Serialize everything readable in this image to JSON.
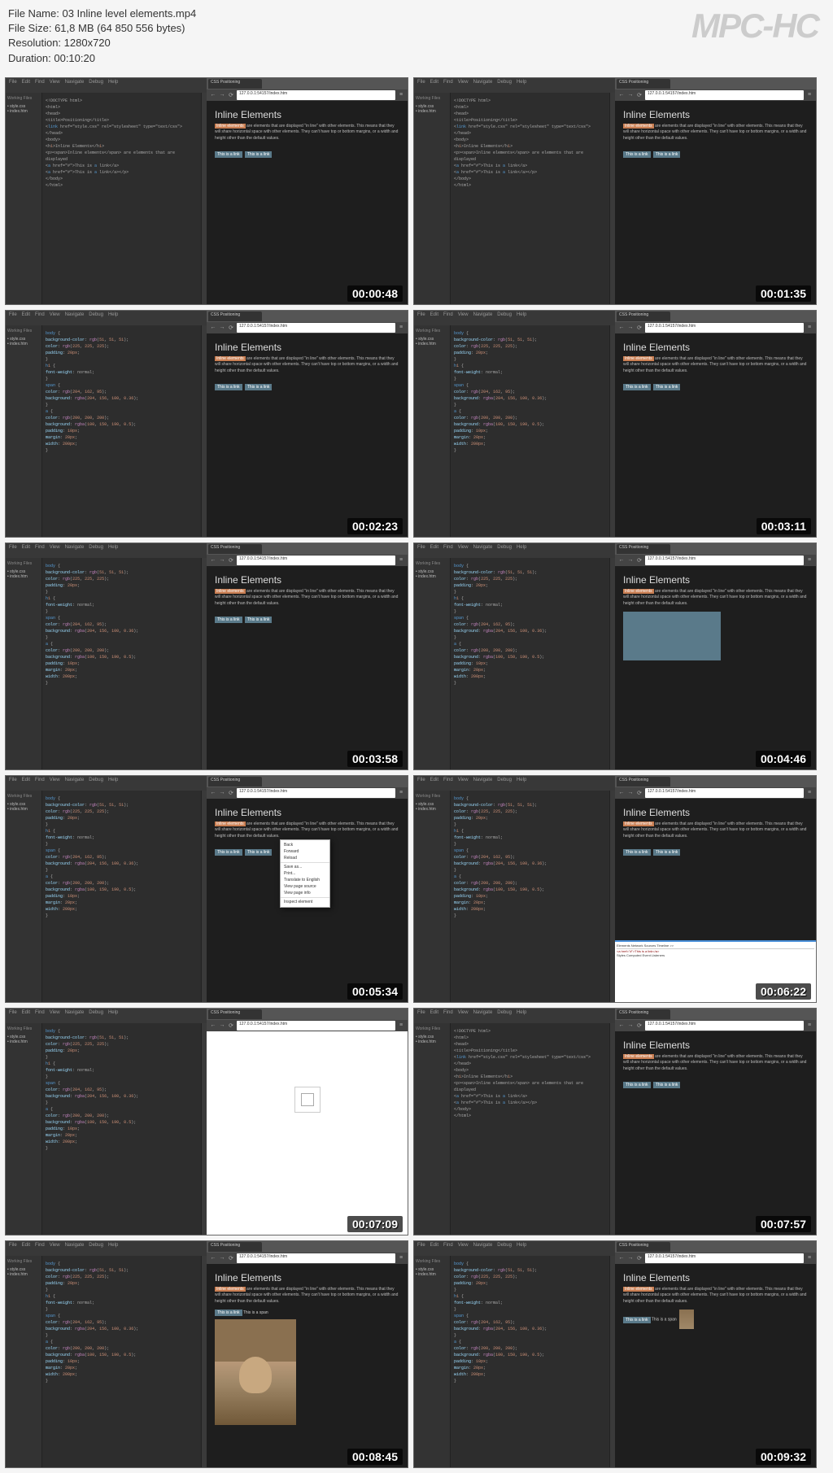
{
  "meta": {
    "filename_label": "File Name: 03 Inline level elements.mp4",
    "filesize_label": "File Size: 61,8 MB (64 850 556 bytes)",
    "resolution_label": "Resolution: 1280x720",
    "duration_label": "Duration: 00:10:20",
    "logo": "MPC-HC"
  },
  "common": {
    "menus": [
      "File",
      "Edit",
      "Find",
      "View",
      "Navigate",
      "Debug",
      "Help"
    ],
    "sidebar_label": "Working Files",
    "url": "127.0.0.1:54157/index.htm",
    "tab_title": "CSS Positioning",
    "heading": "Inline Elements",
    "para_prefix": "Inline elements",
    "para1": "are elements that are displayed \"in line\" with other elements. This means that they will share horizontal space with other elements. They can't have top or bottom margins, or a width and height other than the default values.",
    "para2": "are elements that are displayed \"in line\" with other elements. This means that they will share horizontal space with other elements. They can't have top or bottom margins, or a width and height other than the default values.",
    "link_text": "This is a link",
    "span_text": "This is a span"
  },
  "thumbs": [
    {
      "ts": "00:00:48",
      "kind": "html"
    },
    {
      "ts": "00:01:35",
      "kind": "html"
    },
    {
      "ts": "00:02:23",
      "kind": "css"
    },
    {
      "ts": "00:03:11",
      "kind": "css"
    },
    {
      "ts": "00:03:58",
      "kind": "css"
    },
    {
      "ts": "00:04:46",
      "kind": "css",
      "bigbox": true
    },
    {
      "ts": "00:05:34",
      "kind": "css",
      "ctx": true
    },
    {
      "ts": "00:06:22",
      "kind": "css",
      "devtools": true
    },
    {
      "ts": "00:07:09",
      "kind": "css",
      "light": true
    },
    {
      "ts": "00:07:57",
      "kind": "html"
    },
    {
      "ts": "00:08:45",
      "kind": "css",
      "img": true
    },
    {
      "ts": "00:09:32",
      "kind": "css",
      "imgsm": true
    }
  ],
  "ctx_items": [
    "Back",
    "Forward",
    "Reload",
    "",
    "Save as...",
    "Print...",
    "Translate to English",
    "View page source",
    "View page info",
    "",
    "Inspect element"
  ],
  "code_html": "<!DOCTYPE html>\n<html>\n <head>\n  <title>Positioning</title>\n  <link href=\"style.css\" rel=\"stylesheet\" type=\"text/css\">\n </head>\n <body>\n  <h1>Inline Elements</h1>\n  <p><span>Inline elements</span> are elements that are displayed\n   <a href=\"#\">This is a link</a>\n   <a href=\"#\">This is a link</a></p>\n </body>\n</html>",
  "code_css": "body {\n  background-color: rgb(51, 51, 51);\n  color: rgb(225, 225, 225);\n  padding: 20px;\n}\n\nh1 {\n  font-weight: normal;\n}\n\nspan {\n  color: rgb(204, 162, 95);\n  background: rgba(204, 156, 100, 0.36);\n}\n\na {\n  color: rgb(200, 200, 200);\n  background: rgba(100, 150, 190, 0.5);\n  padding: 10px;\n  margin: 20px;\n  width: 200px;\n}"
}
